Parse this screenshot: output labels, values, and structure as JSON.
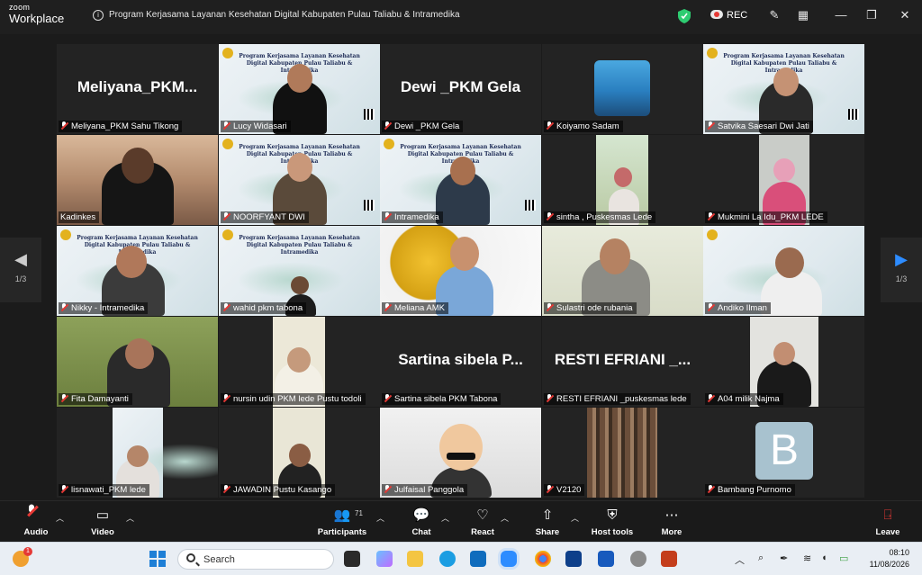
{
  "titlebar": {
    "brand_line1": "zoom",
    "brand_line2": "Workplace",
    "meeting_title": "Program Kerjasama Layanan Kesehatan Digital Kabupaten Pulau Taliabu & Intramedika",
    "rec_label": "REC"
  },
  "slide_text": "Program Kerjasama Layanan Kesehatan Digital Kabupaten Pulau Taliabu & Intramedika",
  "navigation": {
    "page_left": "1/3",
    "page_right": "1/3"
  },
  "participants": [
    {
      "name": "Meliyana_PKM Sahu Tikong",
      "big_name": "Meliyana_PKM..."
    },
    {
      "name": "Lucy Widasari"
    },
    {
      "name": "Dewi _PKM Gela",
      "big_name": "Dewi _PKM Gela"
    },
    {
      "name": "Koiyamo Sadam"
    },
    {
      "name": "Satvika Saesari Dwi Jati"
    },
    {
      "name": "Kadinkes"
    },
    {
      "name": "NOORFYANT DWI"
    },
    {
      "name": "Intramedika"
    },
    {
      "name": "sintha , Puskesmas Lede"
    },
    {
      "name": "Mukmini La Idu_PKM LEDE"
    },
    {
      "name": "Nikky - Intramedika"
    },
    {
      "name": "wahid pkm tabona"
    },
    {
      "name": "Meliana AMK"
    },
    {
      "name": "Sulastri ode rubania"
    },
    {
      "name": "Andiko Ilman"
    },
    {
      "name": "Fita Damayanti"
    },
    {
      "name": "nursin udin PKM lede Pustu todoli"
    },
    {
      "name": "Sartina sibela PKM Tabona",
      "big_name": "Sartina sibela P..."
    },
    {
      "name": "RESTI EFRIANI _puskesmas lede",
      "big_name": "RESTI EFRIANI _..."
    },
    {
      "name": "A04 milik Najma"
    },
    {
      "name": "lisnawati_PKM lede"
    },
    {
      "name": "JAWADIN Pustu Kasango"
    },
    {
      "name": "Julfaisal Panggola"
    },
    {
      "name": "V2120"
    },
    {
      "name": "Bambang Purnomo",
      "avatar_letter": "B"
    }
  ],
  "toolbar": {
    "audio": "Audio",
    "video": "Video",
    "participants": "Participants",
    "participants_count": "71",
    "chat": "Chat",
    "react": "React",
    "share": "Share",
    "host_tools": "Host tools",
    "more": "More",
    "leave": "Leave"
  },
  "taskbar": {
    "search_placeholder": "Search",
    "notification_badge": "1",
    "time": "08:10",
    "date": "11/08/2026"
  },
  "colors": {
    "active_speaker": "#3fb950",
    "muted": "#e53935",
    "slide_bg": "#e4edf1"
  }
}
